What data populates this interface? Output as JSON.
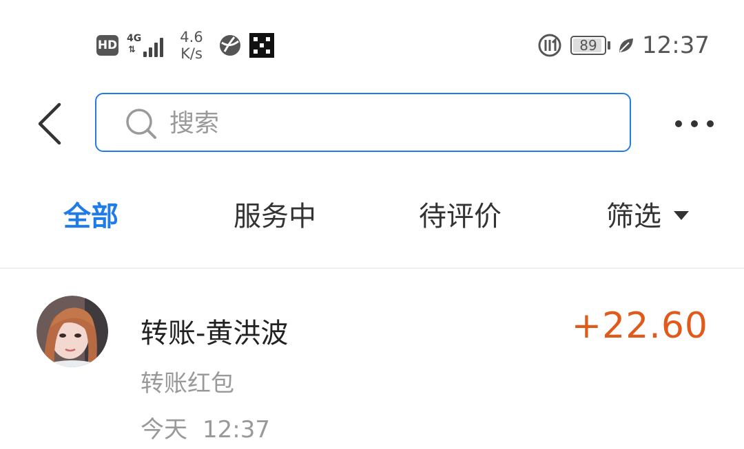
{
  "status_bar": {
    "hd_label": "HD",
    "network_type": "4G",
    "network_arrows": "⇅",
    "speed_value": "4.6",
    "speed_unit": "K/s",
    "battery_level": "89",
    "time": "12:37"
  },
  "header": {
    "back_icon": "chevron-left-icon",
    "search_placeholder": "搜索",
    "more_icon": "more-horizontal-icon"
  },
  "tabs": [
    {
      "label": "全部",
      "active": true
    },
    {
      "label": "服务中",
      "active": false
    },
    {
      "label": "待评价",
      "active": false
    },
    {
      "label": "筛选",
      "active": false
    }
  ],
  "transactions": [
    {
      "title": "转账-黄洪波",
      "subtitle": "转账红包",
      "date": "今天",
      "time": "12:37",
      "amount": "+22.60"
    }
  ],
  "colors": {
    "accent": "#1f7be8",
    "amount": "#e05a1c",
    "secondary_text": "#999999"
  }
}
